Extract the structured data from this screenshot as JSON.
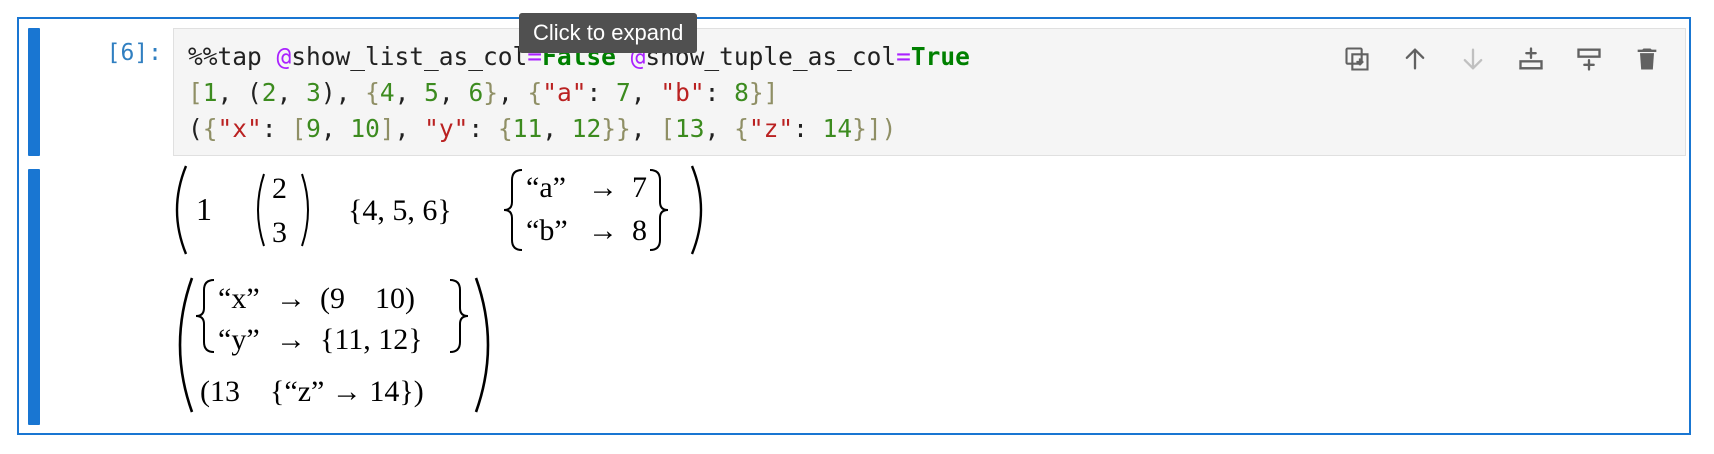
{
  "cell": {
    "prompt": "[6]:",
    "tooltip": "Click to expand",
    "code_lines": [
      [
        {
          "t": "%%tap ",
          "c": "t-pun"
        },
        {
          "t": "@",
          "c": "t-at"
        },
        {
          "t": "show_list_as_col",
          "c": "t-pun"
        },
        {
          "t": "=",
          "c": "t-at"
        },
        {
          "t": "False",
          "c": "t-kw"
        },
        {
          "t": " ",
          "c": "t-pun"
        },
        {
          "t": "@",
          "c": "t-at"
        },
        {
          "t": "show_tuple_as_col",
          "c": "t-pun"
        },
        {
          "t": "=",
          "c": "t-at"
        },
        {
          "t": "True",
          "c": "t-kw"
        }
      ],
      [
        {
          "t": "[",
          "c": "t-br1"
        },
        {
          "t": "1",
          "c": "t-num"
        },
        {
          "t": ", (",
          "c": "t-pun"
        },
        {
          "t": "2",
          "c": "t-num"
        },
        {
          "t": ", ",
          "c": "t-pun"
        },
        {
          "t": "3",
          "c": "t-num"
        },
        {
          "t": "), ",
          "c": "t-pun"
        },
        {
          "t": "{",
          "c": "t-br1"
        },
        {
          "t": "4",
          "c": "t-num"
        },
        {
          "t": ", ",
          "c": "t-pun"
        },
        {
          "t": "5",
          "c": "t-num"
        },
        {
          "t": ", ",
          "c": "t-pun"
        },
        {
          "t": "6",
          "c": "t-num"
        },
        {
          "t": "}",
          "c": "t-br1"
        },
        {
          "t": ", ",
          "c": "t-pun"
        },
        {
          "t": "{",
          "c": "t-br1"
        },
        {
          "t": "\"a\"",
          "c": "t-str"
        },
        {
          "t": ": ",
          "c": "t-pun"
        },
        {
          "t": "7",
          "c": "t-num"
        },
        {
          "t": ", ",
          "c": "t-pun"
        },
        {
          "t": "\"b\"",
          "c": "t-str"
        },
        {
          "t": ": ",
          "c": "t-pun"
        },
        {
          "t": "8",
          "c": "t-num"
        },
        {
          "t": "}]",
          "c": "t-br1"
        }
      ],
      [
        {
          "t": "(",
          "c": "t-pun"
        },
        {
          "t": "{",
          "c": "t-br1"
        },
        {
          "t": "\"x\"",
          "c": "t-str"
        },
        {
          "t": ": ",
          "c": "t-pun"
        },
        {
          "t": "[",
          "c": "t-br1"
        },
        {
          "t": "9",
          "c": "t-num"
        },
        {
          "t": ", ",
          "c": "t-pun"
        },
        {
          "t": "10",
          "c": "t-num"
        },
        {
          "t": "]",
          "c": "t-br1"
        },
        {
          "t": ", ",
          "c": "t-pun"
        },
        {
          "t": "\"y\"",
          "c": "t-str"
        },
        {
          "t": ": ",
          "c": "t-pun"
        },
        {
          "t": "{",
          "c": "t-br1"
        },
        {
          "t": "11",
          "c": "t-num"
        },
        {
          "t": ", ",
          "c": "t-pun"
        },
        {
          "t": "12",
          "c": "t-num"
        },
        {
          "t": "}}",
          "c": "t-br1"
        },
        {
          "t": ", ",
          "c": "t-pun"
        },
        {
          "t": "[",
          "c": "t-br1"
        },
        {
          "t": "13",
          "c": "t-num"
        },
        {
          "t": ", ",
          "c": "t-pun"
        },
        {
          "t": "{",
          "c": "t-br1"
        },
        {
          "t": "\"z\"",
          "c": "t-str"
        },
        {
          "t": ": ",
          "c": "t-pun"
        },
        {
          "t": "14",
          "c": "t-num"
        },
        {
          "t": "}])",
          "c": "t-br1"
        }
      ]
    ],
    "toolbar": [
      {
        "name": "duplicate-cell-button",
        "icon": "duplicate-icon",
        "disabled": false
      },
      {
        "name": "move-up-button",
        "icon": "arrow-up-icon",
        "disabled": false
      },
      {
        "name": "move-down-button",
        "icon": "arrow-down-icon",
        "disabled": true
      },
      {
        "name": "insert-above-button",
        "icon": "insert-above-icon",
        "disabled": false
      },
      {
        "name": "insert-below-button",
        "icon": "insert-below-icon",
        "disabled": false
      },
      {
        "name": "delete-cell-button",
        "icon": "trash-icon",
        "disabled": false
      }
    ]
  },
  "output": {
    "row1": {
      "item1": "1",
      "tuple": [
        "2",
        "3"
      ],
      "set": "{4, 5, 6}",
      "dict": [
        {
          "key": "“a”",
          "arrow": "→",
          "val": "7"
        },
        {
          "key": "“b”",
          "arrow": "→",
          "val": "8"
        }
      ]
    },
    "row2": {
      "dict": [
        {
          "key": "“x”",
          "arrow": "→",
          "val": "(9    10)"
        },
        {
          "key": "“y”",
          "arrow": "→",
          "val": "{11, 12}"
        }
      ],
      "last": "(13    {“z” → 14})"
    }
  },
  "colors": {
    "accent": "#1976d2",
    "prompt": "#307fc1",
    "editor_bg": "#f5f5f5",
    "tooltip_bg": "#505050"
  }
}
